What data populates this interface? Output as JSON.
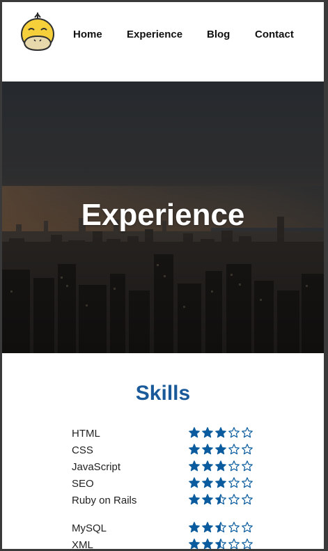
{
  "nav": {
    "items": [
      {
        "label": "Home"
      },
      {
        "label": "Experience"
      },
      {
        "label": "Blog"
      },
      {
        "label": "Contact"
      }
    ]
  },
  "hero": {
    "title": "Experience"
  },
  "skills": {
    "title": "Skills",
    "items": [
      {
        "name": "HTML",
        "rating": 3,
        "max": 5
      },
      {
        "name": "CSS",
        "rating": 3,
        "max": 5
      },
      {
        "name": "JavaScript",
        "rating": 3,
        "max": 5
      },
      {
        "name": "SEO",
        "rating": 3,
        "max": 5
      },
      {
        "name": "Ruby on Rails",
        "rating": 2.5,
        "max": 5
      },
      {
        "name": "MySQL",
        "rating": 2.5,
        "max": 5
      },
      {
        "name": "XML",
        "rating": 2.5,
        "max": 5
      }
    ]
  },
  "colors": {
    "accent": "#1a5a9a",
    "star": "#0b5c9e",
    "text": "#222222"
  },
  "icons": {
    "logo": "duck-logo-icon",
    "star_full": "star-filled-icon",
    "star_half": "star-half-icon",
    "star_empty": "star-outline-icon"
  }
}
